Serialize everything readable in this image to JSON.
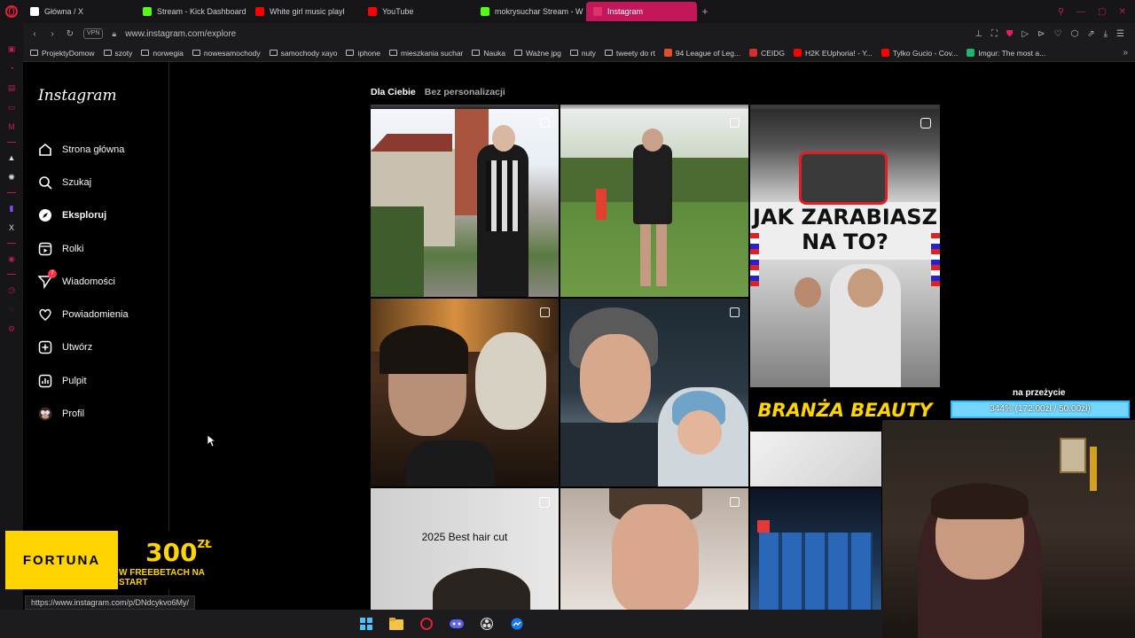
{
  "browser": {
    "tabs": [
      {
        "title": "Główna / X",
        "icon": "x-icon",
        "color": "#ffffff",
        "active": false
      },
      {
        "title": "Stream - Kick Dashboard",
        "icon": "kick-icon",
        "color": "#53fc18",
        "active": false
      },
      {
        "title": "White girl music playl",
        "icon": "youtube-icon",
        "color": "#ff0000",
        "active": false
      },
      {
        "title": "YouTube",
        "icon": "youtube-icon",
        "color": "#ff0000",
        "active": false
      },
      {
        "title": "mokrysuchar Stream - W",
        "icon": "kick-icon",
        "color": "#53fc18",
        "active": false
      },
      {
        "title": "Instagram",
        "icon": "instagram-icon",
        "color": "#e1306c",
        "active": true
      }
    ],
    "url": "www.instagram.com/explore",
    "vpn_label": "VPN",
    "bookmarks": [
      {
        "label": "ProjektyDomow",
        "type": "folder"
      },
      {
        "label": "szoty",
        "type": "folder"
      },
      {
        "label": "norwegia",
        "type": "folder"
      },
      {
        "label": "nowesamochody",
        "type": "folder"
      },
      {
        "label": "samochody xayo",
        "type": "folder"
      },
      {
        "label": "iphone",
        "type": "folder"
      },
      {
        "label": "mieszkania suchar",
        "type": "folder"
      },
      {
        "label": "Nauka",
        "type": "folder"
      },
      {
        "label": "Ważne jpg",
        "type": "folder"
      },
      {
        "label": "nuty",
        "type": "folder"
      },
      {
        "label": "tweety do rt",
        "type": "folder"
      },
      {
        "label": "94 League of Leg...",
        "type": "site",
        "color": "#e0502a"
      },
      {
        "label": "CEIDG",
        "type": "site",
        "color": "#d32f2f"
      },
      {
        "label": "H2K EUphoria! - Y...",
        "type": "site",
        "color": "#ff0000"
      },
      {
        "label": "Tylko Gucio - Cov...",
        "type": "site",
        "color": "#ff0000"
      },
      {
        "label": "Imgur: The most a...",
        "type": "site",
        "color": "#1bb76e"
      }
    ]
  },
  "instagram": {
    "logo": "Instagram",
    "nav": [
      {
        "label": "Strona główna",
        "icon": "home-icon",
        "active": false
      },
      {
        "label": "Szukaj",
        "icon": "search-icon",
        "active": false
      },
      {
        "label": "Eksploruj",
        "icon": "compass-icon",
        "active": true
      },
      {
        "label": "Rolki",
        "icon": "reels-icon",
        "active": false
      },
      {
        "label": "Wiadomości",
        "icon": "messenger-icon",
        "active": false,
        "badge": "7"
      },
      {
        "label": "Powiadomienia",
        "icon": "heart-icon",
        "active": false
      },
      {
        "label": "Utwórz",
        "icon": "plus-square-icon",
        "active": false
      },
      {
        "label": "Pulpit",
        "icon": "chart-icon",
        "active": false
      },
      {
        "label": "Profil",
        "icon": "avatar-icon",
        "active": false
      }
    ],
    "feed_tabs": {
      "for_you": "Dla Ciebie",
      "no_personalization": "Bez personalizacji"
    },
    "tiles": {
      "zarabiasz_line1": "JAK ZARABIASZ",
      "zarabiasz_line2": "NA TO?",
      "branza": "BRANŻA BEAUTY",
      "haircut": "2025 Best hair cut"
    }
  },
  "overlays": {
    "progress_label": "na przeżycie",
    "progress_text": "344% (172.00zł / 50.00zł)",
    "progress_fraction": 1.0,
    "ad_brand": "FORTUNA",
    "ad_amount": "300",
    "ad_currency": "ZŁ",
    "ad_sub": "W FREEBETACH NA START",
    "status_url": "https://www.instagram.com/p/DNdcykvo6My/"
  }
}
